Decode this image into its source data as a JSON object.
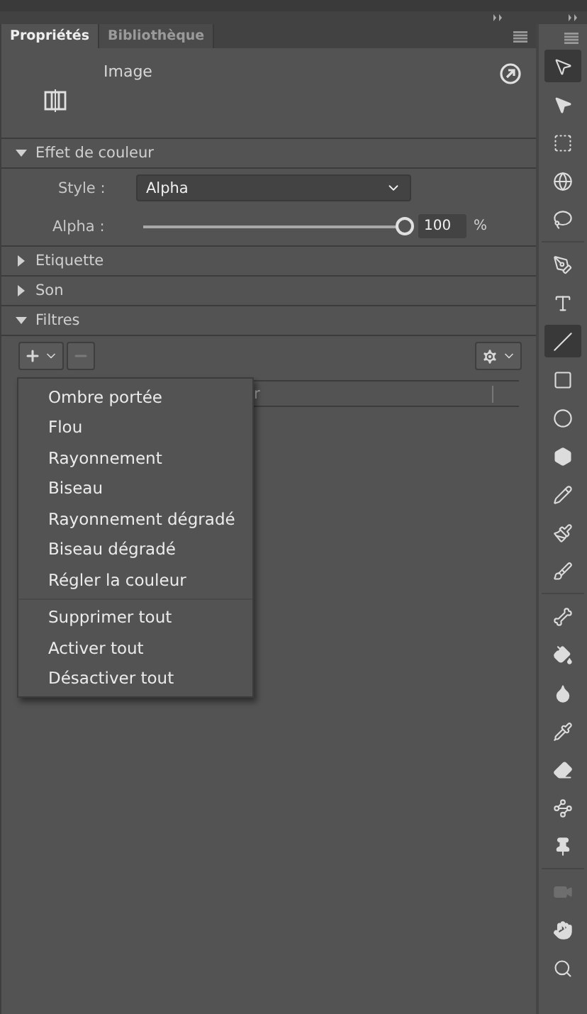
{
  "tabs": [
    {
      "label": "Propriétés",
      "selected": true
    },
    {
      "label": "Bibliothèque",
      "selected": false
    }
  ],
  "object": {
    "name": "Image"
  },
  "sections": [
    {
      "title": "Effet de couleur",
      "expanded": true
    },
    {
      "title": "Etiquette",
      "expanded": false
    },
    {
      "title": "Son",
      "expanded": false
    },
    {
      "title": "Filtres",
      "expanded": true
    }
  ],
  "color_effect": {
    "style_label": "Style :",
    "style_value": "Alpha",
    "alpha_label": "Alpha :",
    "alpha": {
      "level": 1,
      "value": "100",
      "unit": "%"
    }
  },
  "filters": {
    "remove_disabled": true,
    "column_1": "r"
  },
  "add_menu": {
    "groups": [
      [
        "Ombre portée",
        "Flou",
        "Rayonnement",
        "Biseau",
        "Rayonnement dégradé",
        "Biseau dégradé",
        "Régler la couleur"
      ],
      [
        "Supprimer tout",
        "Activer tout",
        "Désactiver tout"
      ]
    ]
  },
  "tools": [
    {
      "selected": true,
      "disabled": false
    },
    {
      "selected": false,
      "disabled": false
    },
    {
      "selected": false,
      "disabled": false
    },
    {
      "selected": false,
      "disabled": false
    },
    {
      "selected": false,
      "disabled": false
    },
    {
      "selected": false,
      "disabled": false
    },
    {
      "selected": false,
      "disabled": false
    },
    {
      "selected": true,
      "disabled": false
    },
    {
      "selected": false,
      "disabled": false
    },
    {
      "selected": false,
      "disabled": false
    },
    {
      "selected": false,
      "disabled": false
    },
    {
      "selected": false,
      "disabled": false
    },
    {
      "selected": false,
      "disabled": false
    },
    {
      "selected": false,
      "disabled": false
    },
    {
      "selected": false,
      "disabled": false
    },
    {
      "selected": false,
      "disabled": false
    },
    {
      "selected": false,
      "disabled": false
    },
    {
      "selected": false,
      "disabled": false
    },
    {
      "selected": false,
      "disabled": false
    },
    {
      "selected": false,
      "disabled": false
    },
    {
      "selected": false,
      "disabled": false
    },
    {
      "selected": false,
      "disabled": true
    },
    {
      "selected": false,
      "disabled": false
    },
    {
      "selected": false,
      "disabled": false
    }
  ]
}
